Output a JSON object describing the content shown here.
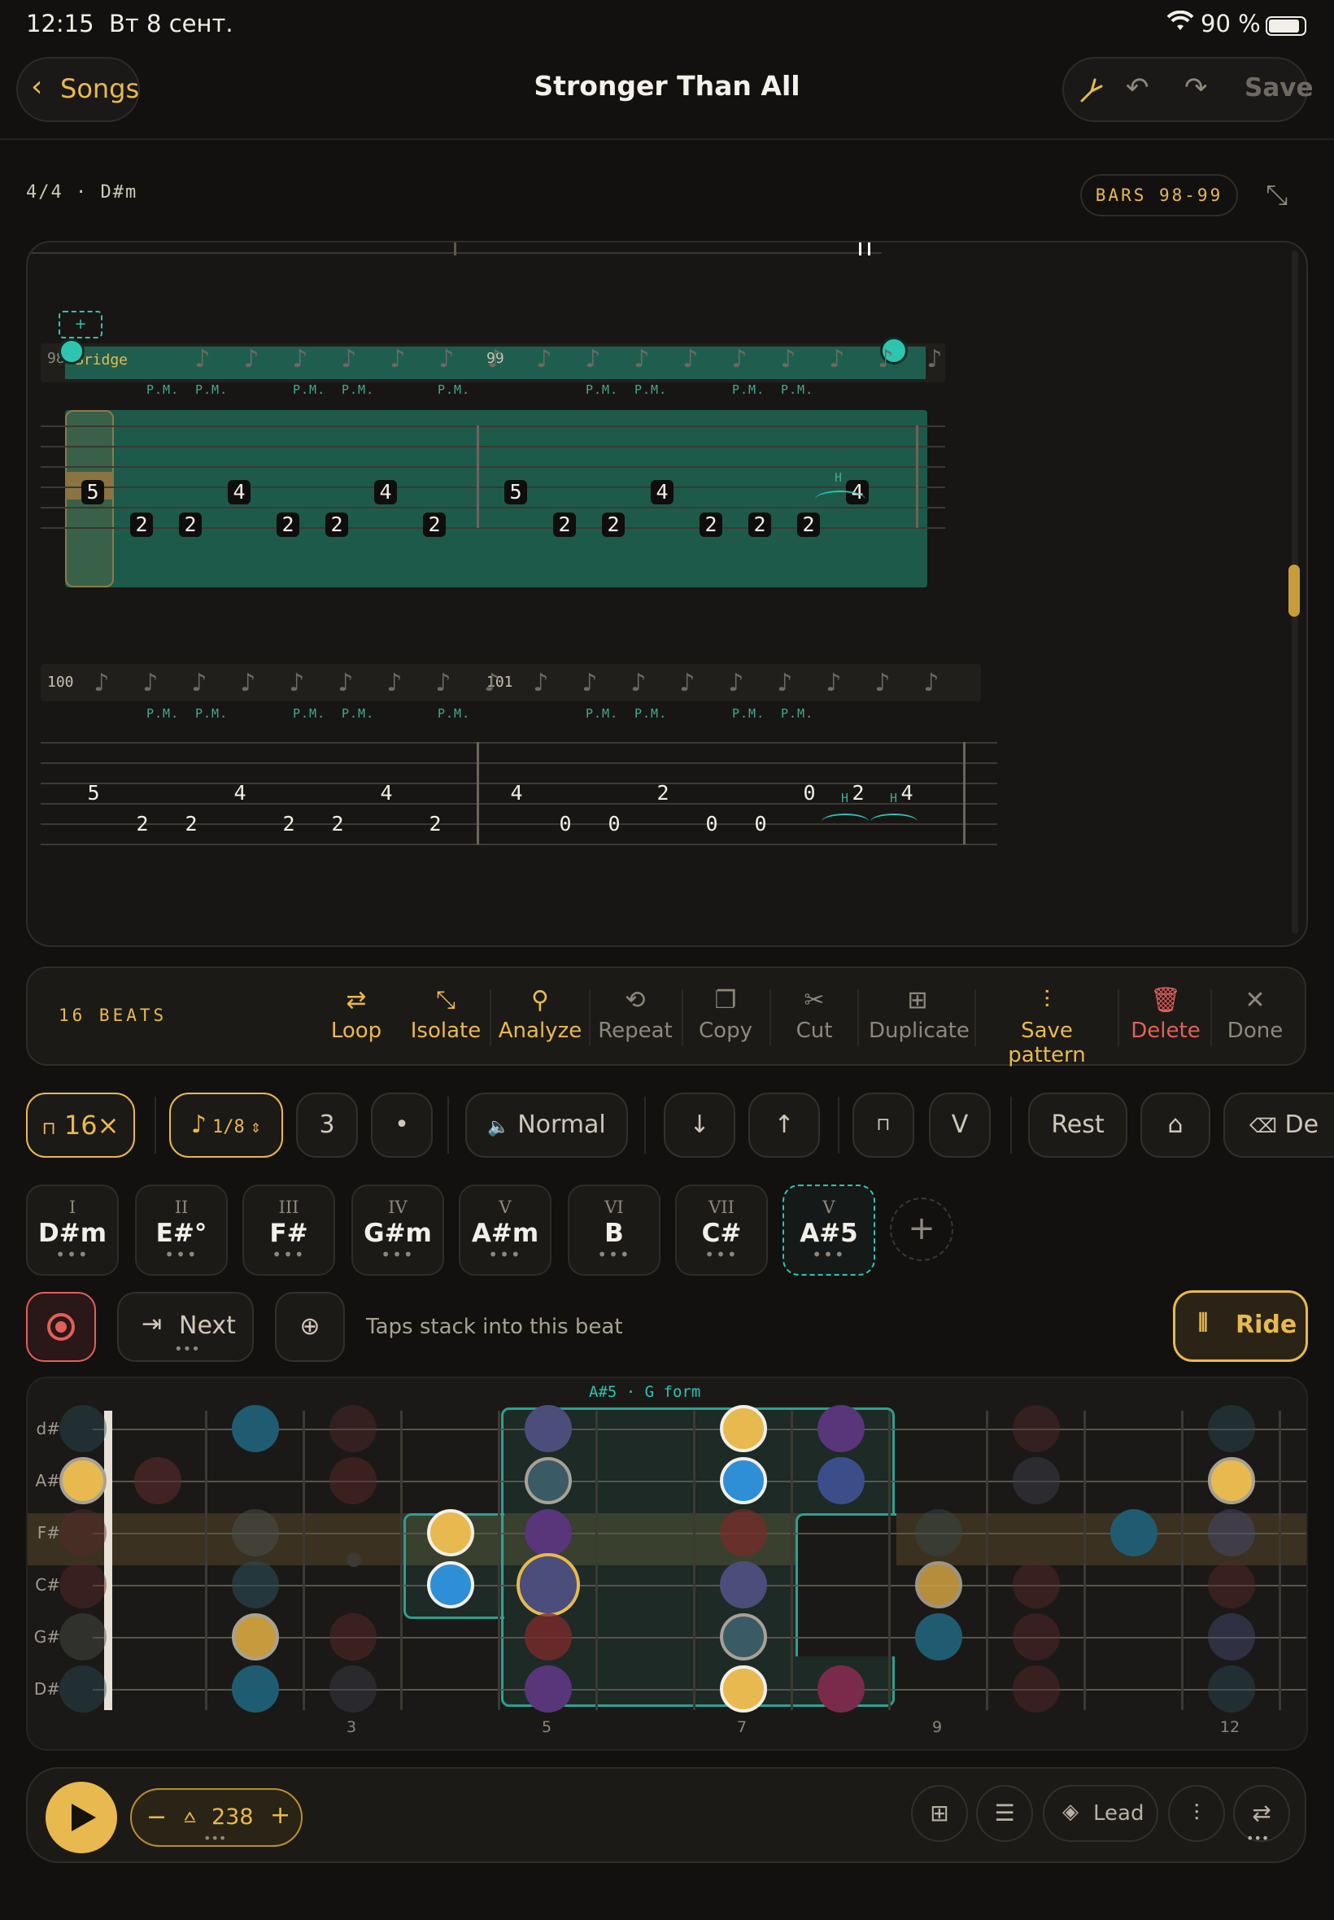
{
  "status": {
    "time": "12:15",
    "date": "Вт 8 сент.",
    "battery": "90 %"
  },
  "header": {
    "back_label": "Songs",
    "title": "Stronger Than All",
    "save_label": "Save"
  },
  "meta": {
    "time_sig": "4/4 · D#m",
    "bars": "BARS 98-99"
  },
  "tab": {
    "section_label": "Bridge",
    "bar98": "98",
    "bar99": "99",
    "bar100": "100",
    "bar101": "101",
    "pm": "P.M.",
    "hammer": "H",
    "add": "+",
    "row1_frets": [
      "5",
      "2",
      "2",
      "4",
      "2",
      "2",
      "4",
      "2",
      "5",
      "2",
      "2",
      "4",
      "2",
      "2",
      "2",
      "4"
    ],
    "row2_frets": [
      "5",
      "2",
      "2",
      "4",
      "2",
      "2",
      "4",
      "2",
      "4",
      "0",
      "0",
      "2",
      "0",
      "0",
      "0",
      "2",
      "4"
    ]
  },
  "toolbar": {
    "beats": "16 BEATS",
    "tools": [
      "Loop",
      "Isolate",
      "Analyze",
      "Repeat",
      "Copy",
      "Cut",
      "Duplicate",
      "Save pattern",
      "Delete",
      "Done"
    ]
  },
  "controls": {
    "speed": "16×",
    "note_value": "1/8",
    "tuplet": "3",
    "dot": "•",
    "articulation": "Normal",
    "pick_down": "↓",
    "pick_up": "↑",
    "downstroke": "⊓",
    "upstroke": "V",
    "rest": "Rest",
    "delete": "De"
  },
  "chords": [
    {
      "roman": "I",
      "name": "D#m"
    },
    {
      "roman": "II",
      "name": "E#°"
    },
    {
      "roman": "III",
      "name": "F#"
    },
    {
      "roman": "IV",
      "name": "G#m"
    },
    {
      "roman": "V",
      "name": "A#m"
    },
    {
      "roman": "VI",
      "name": "B"
    },
    {
      "roman": "VII",
      "name": "C#"
    },
    {
      "roman": "V",
      "name": "A#5"
    }
  ],
  "chord_dots": "•••",
  "action_row": {
    "next_label": "Next",
    "hint": "Taps stack into this beat",
    "ride_label": "Ride"
  },
  "fretboard": {
    "shape_label": "A#5 · G form",
    "strings": [
      "d#",
      "A#",
      "F#",
      "C#",
      "G#",
      "D#"
    ],
    "fret_markers": [
      "3",
      "5",
      "7",
      "9",
      "12"
    ]
  },
  "bottom": {
    "tempo": "238",
    "lead_label": "Lead"
  },
  "colors": {
    "accent": "#e8b94f",
    "teal": "#2ec4b0",
    "danger": "#e2605a"
  }
}
